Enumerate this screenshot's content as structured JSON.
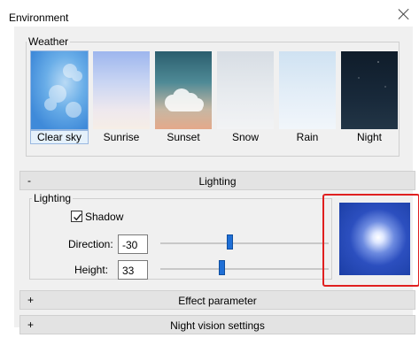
{
  "window": {
    "title": "Environment"
  },
  "weather": {
    "group_label": "Weather",
    "items": [
      {
        "label": "Clear sky",
        "selected": true,
        "icon": "clear-sky-preset"
      },
      {
        "label": "Sunrise",
        "selected": false,
        "icon": "sunrise-preset"
      },
      {
        "label": "Sunset",
        "selected": false,
        "icon": "sunset-preset"
      },
      {
        "label": "Snow",
        "selected": false,
        "icon": "snow-preset"
      },
      {
        "label": "Rain",
        "selected": false,
        "icon": "rain-preset"
      },
      {
        "label": "Night",
        "selected": false,
        "icon": "night-preset"
      }
    ]
  },
  "lighting": {
    "section_sign": "-",
    "section_label": "Lighting",
    "group_label": "Lighting",
    "shadow": {
      "label": "Shadow",
      "checked": true
    },
    "direction": {
      "label": "Direction:",
      "value": "-30",
      "slider_fraction": 0.42
    },
    "height": {
      "label": "Height:",
      "value": "33",
      "slider_fraction": 0.37
    },
    "preview_color": "#1c3fa6",
    "highlight_color": "#e02020"
  },
  "effect": {
    "sign": "+",
    "label": "Effect parameter"
  },
  "night_vision": {
    "sign": "+",
    "label": "Night vision settings"
  }
}
